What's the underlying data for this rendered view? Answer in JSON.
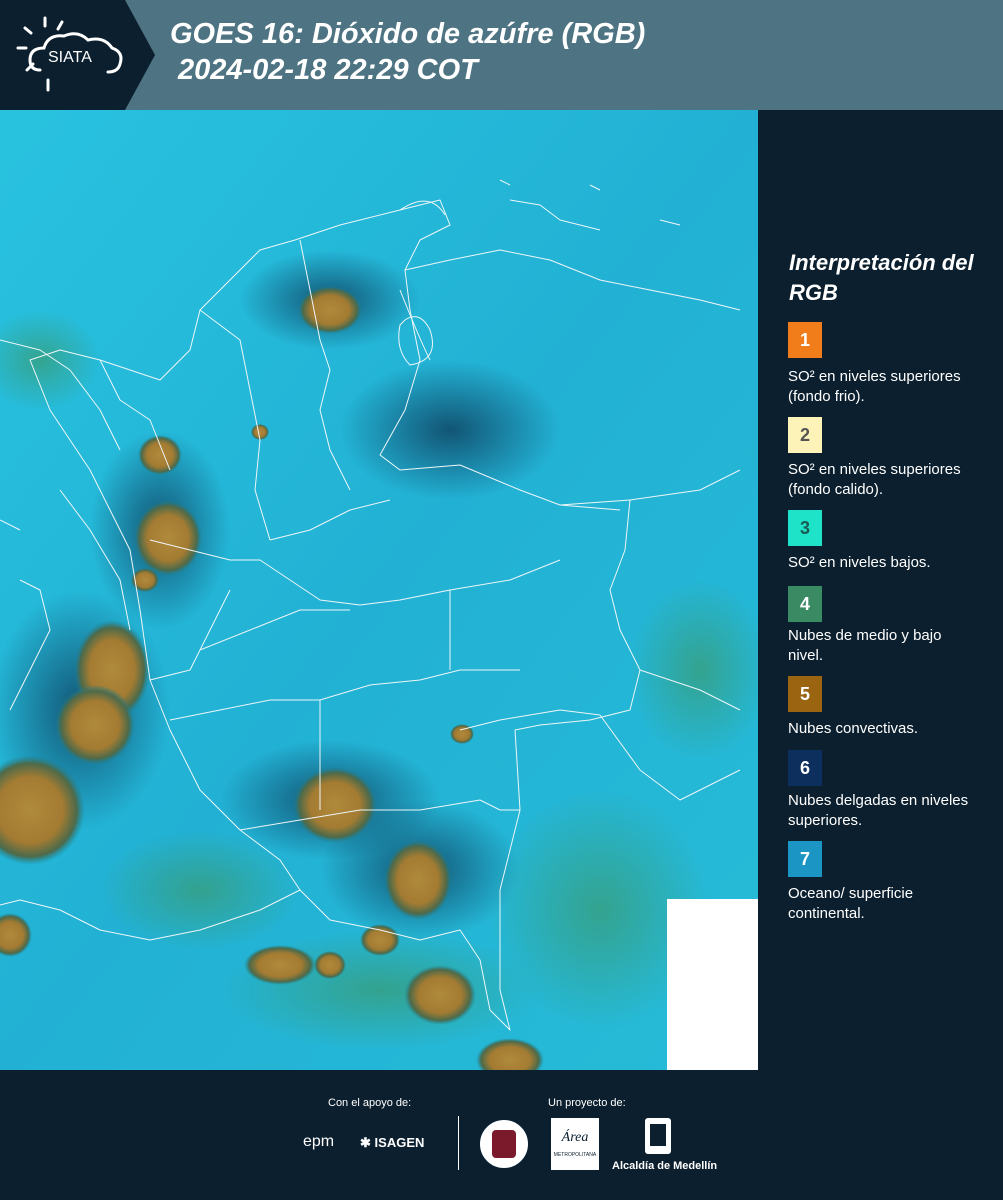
{
  "header": {
    "title_line1": "GOES 16: Dióxido de azúfre (RGB)",
    "title_line2": "2024-02-18 22:29 COT",
    "logo_text": "SIATA"
  },
  "legend": {
    "title": "Interpretación del RGB",
    "items": [
      {
        "number": "1",
        "color": "#f07d1a",
        "text": "SO² en niveles superiores (fondo frio)."
      },
      {
        "number": "2",
        "color": "#fdf3b8",
        "text": "SO² en niveles superiores (fondo calido)."
      },
      {
        "number": "3",
        "color": "#1ee3c8",
        "text": "SO² en niveles bajos."
      },
      {
        "number": "4",
        "color": "#3a8a63",
        "text": "Nubes de medio y bajo nivel."
      },
      {
        "number": "5",
        "color": "#9a6410",
        "text": "Nubes convectivas."
      },
      {
        "number": "6",
        "color": "#0c2f5e",
        "text": "Nubes delgadas en niveles superiores."
      },
      {
        "number": "7",
        "color": "#1a95c4",
        "text": "Oceano/ superficie continental."
      }
    ]
  },
  "footer": {
    "support_label": "Con el apoyo de:",
    "project_label": "Un proyecto de:",
    "epm_text": "epm",
    "isagen_text": "ISAGEN",
    "alcaldia_text": "Alcaldía de Medellín",
    "area_text": "Área",
    "area_subtext": "METROPOLITANA"
  },
  "colors": {
    "header_bg": "#4e7483",
    "panel_bg": "#0b1f2e",
    "map_base": "#22b6d6",
    "convective": "#a37b32"
  }
}
